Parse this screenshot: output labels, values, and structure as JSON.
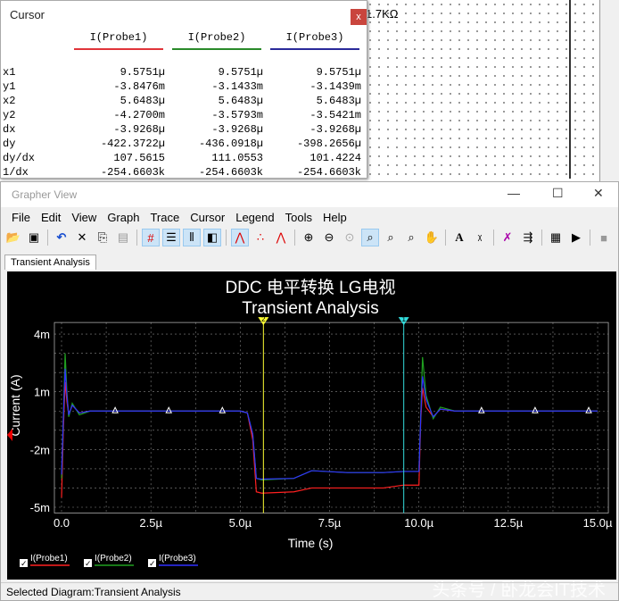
{
  "schematic": {
    "resistor_label": "1.7KΩ"
  },
  "cursor_window": {
    "title": "Cursor",
    "close": "x",
    "columns": [
      {
        "label": "I(Probe1)",
        "color": "#e0343a"
      },
      {
        "label": "I(Probe2)",
        "color": "#2a8a2a"
      },
      {
        "label": "I(Probe3)",
        "color": "#2a2a9a"
      }
    ],
    "rows": [
      {
        "label": "x1",
        "values": [
          "9.5751µ",
          "9.5751µ",
          "9.5751µ"
        ]
      },
      {
        "label": "y1",
        "values": [
          "-3.8476m",
          "-3.1433m",
          "-3.1439m"
        ]
      },
      {
        "label": "x2",
        "values": [
          "5.6483µ",
          "5.6483µ",
          "5.6483µ"
        ]
      },
      {
        "label": "y2",
        "values": [
          "-4.2700m",
          "-3.5793m",
          "-3.5421m"
        ]
      },
      {
        "label": "dx",
        "values": [
          "-3.9268µ",
          "-3.9268µ",
          "-3.9268µ"
        ]
      },
      {
        "label": "dy",
        "values": [
          "-422.3722µ",
          "-436.0918µ",
          "-398.2656µ"
        ]
      },
      {
        "label": "dy/dx",
        "values": [
          "107.5615",
          "111.0553",
          "101.4224"
        ]
      },
      {
        "label": "1/dx",
        "values": [
          "-254.6603k",
          "-254.6603k",
          "-254.6603k"
        ]
      }
    ]
  },
  "grapher": {
    "title": "Grapher View",
    "window_controls": [
      "—",
      "☐",
      "✕"
    ],
    "menu": [
      "File",
      "Edit",
      "View",
      "Graph",
      "Trace",
      "Cursor",
      "Legend",
      "Tools",
      "Help"
    ],
    "tab": "Transient Analysis",
    "status": "Selected Diagram:Transient Analysis",
    "watermark": "头条号 / 卧龙会IT技术"
  },
  "chart_data": {
    "type": "line",
    "title": "DDC 电平转换 LG电视",
    "subtitle": "Transient Analysis",
    "xlabel": "Time (s)",
    "ylabel": "Current (A)",
    "xlim": [
      -0.3,
      15.3
    ],
    "ylim": [
      -5.3,
      4.6
    ],
    "xticks": [
      0,
      2.5,
      5,
      7.5,
      10,
      12.5,
      15
    ],
    "xtick_labels": [
      "0.0",
      "2.5µ",
      "5.0µ",
      "7.5µ",
      "10.0µ",
      "12.5µ",
      "15.0µ"
    ],
    "yticks": [
      4,
      1,
      -2,
      -5
    ],
    "ytick_labels": [
      "4m",
      "1m",
      "-2m",
      "-5m"
    ],
    "cursors": [
      {
        "label": "2",
        "x": 5.6483,
        "color": "#ffff33"
      },
      {
        "label": "1",
        "x": 9.5751,
        "color": "#33dddd"
      }
    ],
    "series": [
      {
        "name": "I(Probe1)",
        "color": "#ff2020",
        "x": [
          0,
          0.05,
          0.1,
          0.15,
          0.2,
          0.3,
          0.5,
          0.8,
          1.2,
          5.0,
          5.2,
          5.35,
          5.45,
          5.6,
          6.5,
          7.0,
          8,
          9,
          9.575,
          9.6,
          10.0,
          10.05,
          10.1,
          10.2,
          10.4,
          10.6,
          11,
          15
        ],
        "y": [
          -4.5,
          -1,
          1.5,
          0.5,
          -0.2,
          0.3,
          -0.1,
          0,
          0,
          0,
          -0.1,
          -1.5,
          -4.2,
          -4.27,
          -4.2,
          -4.0,
          -4.0,
          -4.0,
          -3.85,
          -3.85,
          -3.85,
          -0.5,
          1.2,
          0.2,
          -0.3,
          0.1,
          0,
          0
        ]
      },
      {
        "name": "I(Probe2)",
        "color": "#20a020",
        "x": [
          0,
          0.05,
          0.1,
          0.15,
          0.2,
          0.3,
          0.5,
          0.8,
          1.2,
          5.0,
          5.2,
          5.35,
          5.45,
          5.6,
          6.5,
          7.0,
          8,
          9,
          9.575,
          9.6,
          10.0,
          10.05,
          10.1,
          10.2,
          10.4,
          10.6,
          11,
          15
        ],
        "y": [
          -3.5,
          -0.5,
          3.0,
          1.0,
          -0.3,
          0.4,
          -0.2,
          0,
          0,
          0,
          -0.1,
          -1.2,
          -3.5,
          -3.58,
          -3.5,
          -3.1,
          -3.2,
          -3.2,
          -3.14,
          -3.14,
          -3.14,
          -0.3,
          2.8,
          0.8,
          -0.4,
          0.2,
          0,
          0
        ]
      },
      {
        "name": "I(Probe3)",
        "color": "#3030ff",
        "x": [
          0,
          0.05,
          0.1,
          0.15,
          0.2,
          0.3,
          0.5,
          0.8,
          1.2,
          5.0,
          5.2,
          5.35,
          5.45,
          5.6,
          6.5,
          7.0,
          8,
          9,
          9.575,
          9.6,
          10.0,
          10.05,
          10.1,
          10.2,
          10.4,
          10.6,
          11,
          15
        ],
        "y": [
          -3.3,
          -0.4,
          2.2,
          0.8,
          -0.2,
          0.3,
          -0.1,
          0,
          0,
          0,
          -0.1,
          -1.2,
          -3.5,
          -3.54,
          -3.5,
          -3.1,
          -3.2,
          -3.2,
          -3.14,
          -3.14,
          -3.14,
          -0.3,
          1.8,
          0.6,
          -0.3,
          0.1,
          0,
          0
        ]
      }
    ],
    "legend": "bottom-left"
  }
}
